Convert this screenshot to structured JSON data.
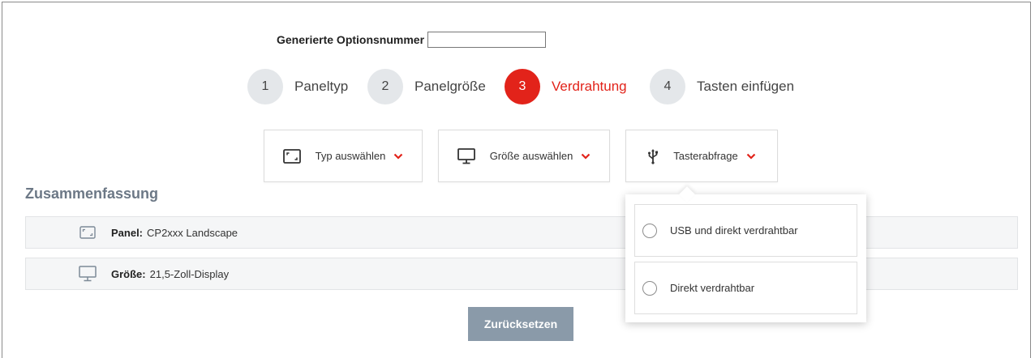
{
  "option_number": {
    "label": "Generierte Optionsnummer",
    "value": ""
  },
  "steps": [
    {
      "number": "1",
      "label": "Paneltyp",
      "active": false
    },
    {
      "number": "2",
      "label": "Panelgröße",
      "active": false
    },
    {
      "number": "3",
      "label": "Verdrahtung",
      "active": true
    },
    {
      "number": "4",
      "label": "Tasten einfügen",
      "active": false
    }
  ],
  "dropdowns": [
    {
      "label": "Typ auswählen",
      "icon": "panel-type-icon"
    },
    {
      "label": "Größe auswählen",
      "icon": "monitor-icon"
    },
    {
      "label": "Tasterabfrage",
      "icon": "usb-icon"
    }
  ],
  "summary": {
    "title": "Zusammenfassung",
    "rows": [
      {
        "key": "Panel:",
        "value": "CP2xxx Landscape",
        "icon": "panel-type-icon"
      },
      {
        "key": "Größe:",
        "value": "21,5-Zoll-Display",
        "icon": "monitor-icon"
      }
    ]
  },
  "reset_label": "Zurücksetzen",
  "popover": {
    "options": [
      {
        "label": "USB und direkt verdrahtbar",
        "selected": false
      },
      {
        "label": "Direkt verdrahtbar",
        "selected": false
      }
    ]
  },
  "colors": {
    "accent": "#e2231a",
    "step_inactive": "#e4e7ea",
    "summary_title": "#6c7886",
    "reset_button": "#8a9aa9"
  }
}
